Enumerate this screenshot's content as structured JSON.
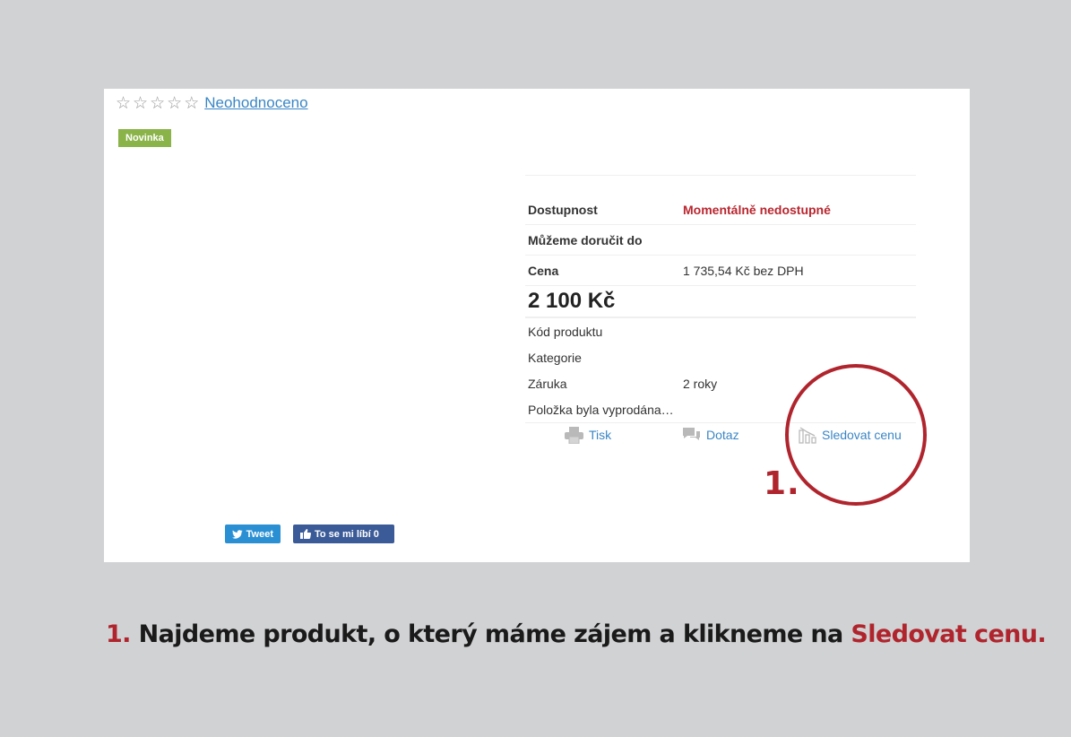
{
  "rating": {
    "stars": [
      "☆",
      "☆",
      "☆",
      "☆",
      "☆"
    ],
    "link_text": "Neohodnoceno"
  },
  "badge": {
    "label": "Novinka",
    "color": "#8ab34a"
  },
  "params": {
    "availability": {
      "label": "Dostupnost",
      "value": "Momentálně nedostupné"
    },
    "delivery": {
      "label": "Můžeme doručit do",
      "value": ""
    },
    "price_row": {
      "label": "Cena",
      "value": "1 735,54 Kč bez DPH"
    },
    "price": "2 100 Kč",
    "code": {
      "label": "Kód produktu",
      "value": ""
    },
    "category": {
      "label": "Kategorie",
      "value": ""
    },
    "warranty": {
      "label": "Záruka",
      "value": "2 roky"
    },
    "sold_out": "Položka byla vyprodána…"
  },
  "actions": {
    "print": "Tisk",
    "question": "Dotaz",
    "watch_price": "Sledovat cenu"
  },
  "social": {
    "tweet": "Tweet",
    "like": "To se mi líbí 0"
  },
  "annotation": {
    "marker": "1.",
    "caption_num": "1.",
    "caption_text": "Najdeme produkt, o který máme zájem a klikneme na",
    "caption_highlight": "Sledovat cenu.",
    "accent_color": "#b0252d"
  }
}
